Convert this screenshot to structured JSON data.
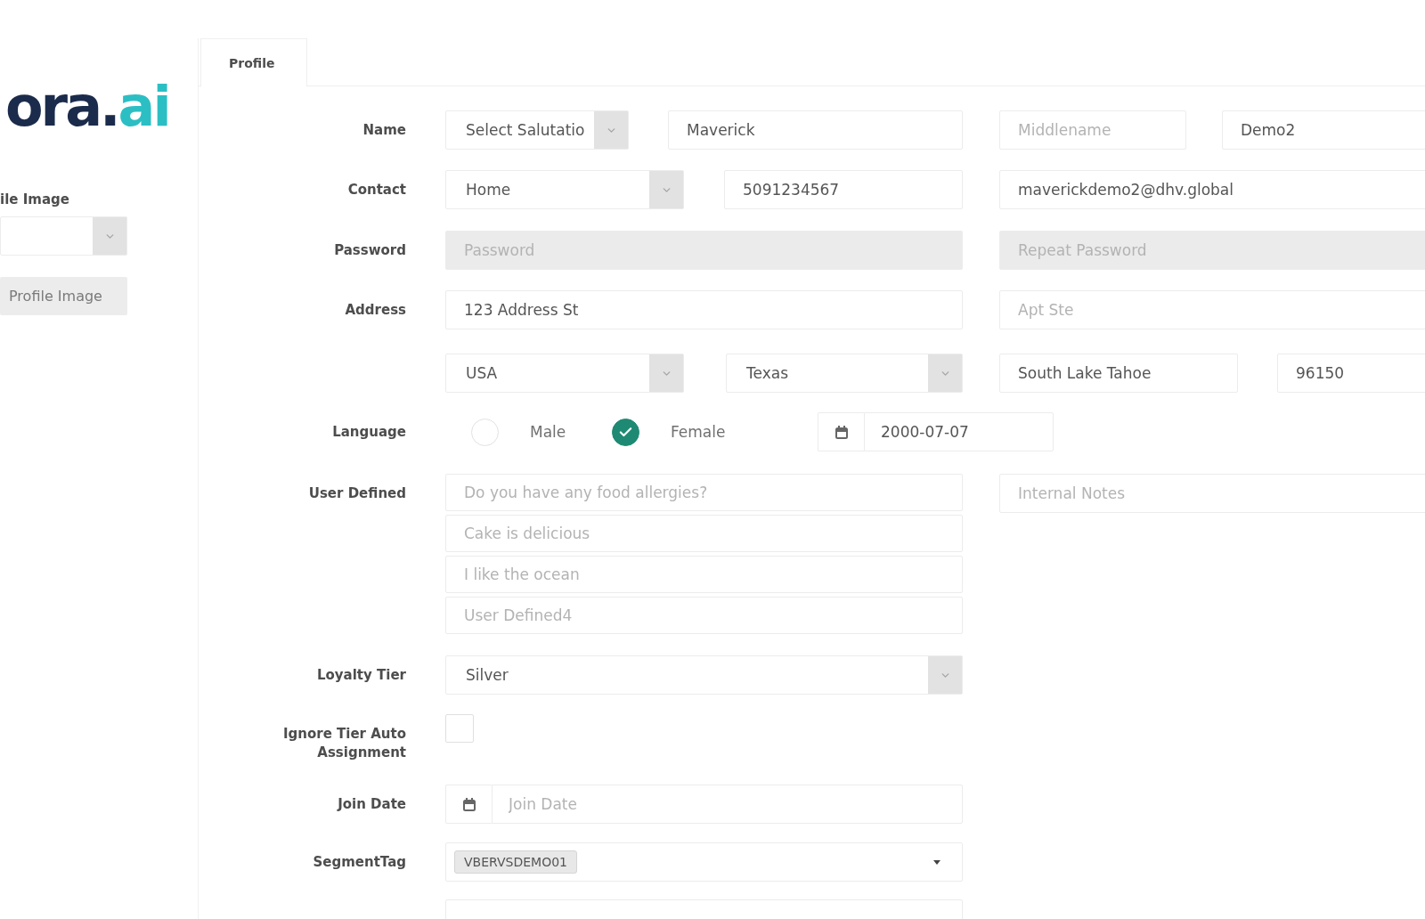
{
  "logo": {
    "text": "ora.",
    "accent": "ai"
  },
  "sidebar": {
    "label": "ile Image",
    "image_field": {
      "kind": "select"
    },
    "button": "Profile Image"
  },
  "tabs": [
    {
      "label": "Profile",
      "selected": true
    }
  ],
  "form": {
    "rows": [
      {
        "label": "Name",
        "fields": [
          {
            "kind": "select",
            "value": "Select Salutatio"
          },
          {
            "kind": "text",
            "value": "Maverick"
          },
          {
            "kind": "text",
            "placeholder": "Middlename"
          },
          {
            "kind": "text",
            "value": "Demo2"
          }
        ]
      },
      {
        "label": "Contact",
        "fields": [
          {
            "kind": "select",
            "value": "Home"
          },
          {
            "kind": "text",
            "value": "5091234567"
          },
          {
            "kind": "text",
            "value": "maverickdemo2@dhv.global"
          }
        ]
      },
      {
        "label": "Password",
        "fields": [
          {
            "kind": "text",
            "placeholder": "Password",
            "disabled": true
          },
          {
            "kind": "text",
            "placeholder": "Repeat Password",
            "disabled": true
          }
        ]
      },
      {
        "label": "Address",
        "fields": [
          {
            "kind": "text",
            "value": "123 Address St"
          },
          {
            "kind": "text",
            "placeholder": "Apt Ste"
          }
        ]
      },
      {
        "fields": [
          {
            "kind": "select",
            "value": "USA"
          },
          {
            "kind": "select",
            "value": "Texas"
          },
          {
            "kind": "text",
            "value": "South Lake Tahoe"
          },
          {
            "kind": "text",
            "value": "96150"
          }
        ]
      },
      {
        "label": "Language",
        "fields": [
          {
            "kind": "radio",
            "label": "Male",
            "selected": false
          },
          {
            "kind": "radio",
            "label": "Female",
            "selected": true
          },
          {
            "kind": "date",
            "value": "2000-07-07"
          }
        ]
      },
      {
        "label": "User Defined",
        "fields": [
          {
            "kind": "stack",
            "items": [
              {
                "placeholder": "Do you have any food allergies?"
              },
              {
                "placeholder": "Cake is delicious"
              },
              {
                "placeholder": "I like the ocean"
              },
              {
                "placeholder": "User Defined4"
              }
            ]
          },
          {
            "kind": "text",
            "placeholder": "Internal Notes"
          }
        ]
      },
      {
        "label": "Loyalty Tier",
        "fields": [
          {
            "kind": "select",
            "value": "Silver"
          }
        ]
      },
      {
        "label": "Ignore Tier Auto Assignment",
        "fields": [
          {
            "kind": "checkbox",
            "checked": false
          }
        ]
      },
      {
        "label": "Join Date",
        "fields": [
          {
            "kind": "date",
            "placeholder": "Join Date"
          }
        ]
      },
      {
        "label": "SegmentTag",
        "fields": [
          {
            "kind": "tags",
            "tags": [
              "VBERVSDEMO01"
            ]
          }
        ]
      },
      {
        "fields": [
          {
            "kind": "text"
          }
        ]
      }
    ]
  }
}
